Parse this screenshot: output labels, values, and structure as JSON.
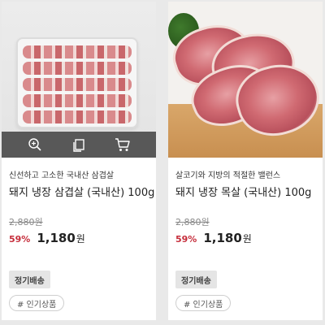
{
  "products": [
    {
      "description": "신선하고 고소한 국내산 삼겹살",
      "name": "돼지 냉장 삼겹살 (국내산) 100g",
      "original_price": "2,880원",
      "discount": "59%",
      "price": "1,180",
      "currency": "원",
      "badge": "정기배송",
      "tag": "# 인기상품",
      "image": "packaged-pork-belly-image",
      "actions": [
        "zoom-icon",
        "copy-icon",
        "cart-icon"
      ]
    },
    {
      "description": "살코기와 지방의 적절한 밸런스",
      "name": "돼지 냉장 목살 (국내산) 100g",
      "original_price": "2,880원",
      "discount": "59%",
      "price": "1,180",
      "currency": "원",
      "badge": "정기배송",
      "tag": "# 인기상품",
      "image": "pork-neck-slices-image"
    }
  ],
  "colors": {
    "discount": "#c62d3b",
    "overlay": "#404040",
    "badge_bg": "#e5e5e5",
    "background": "#e9e9e9"
  }
}
